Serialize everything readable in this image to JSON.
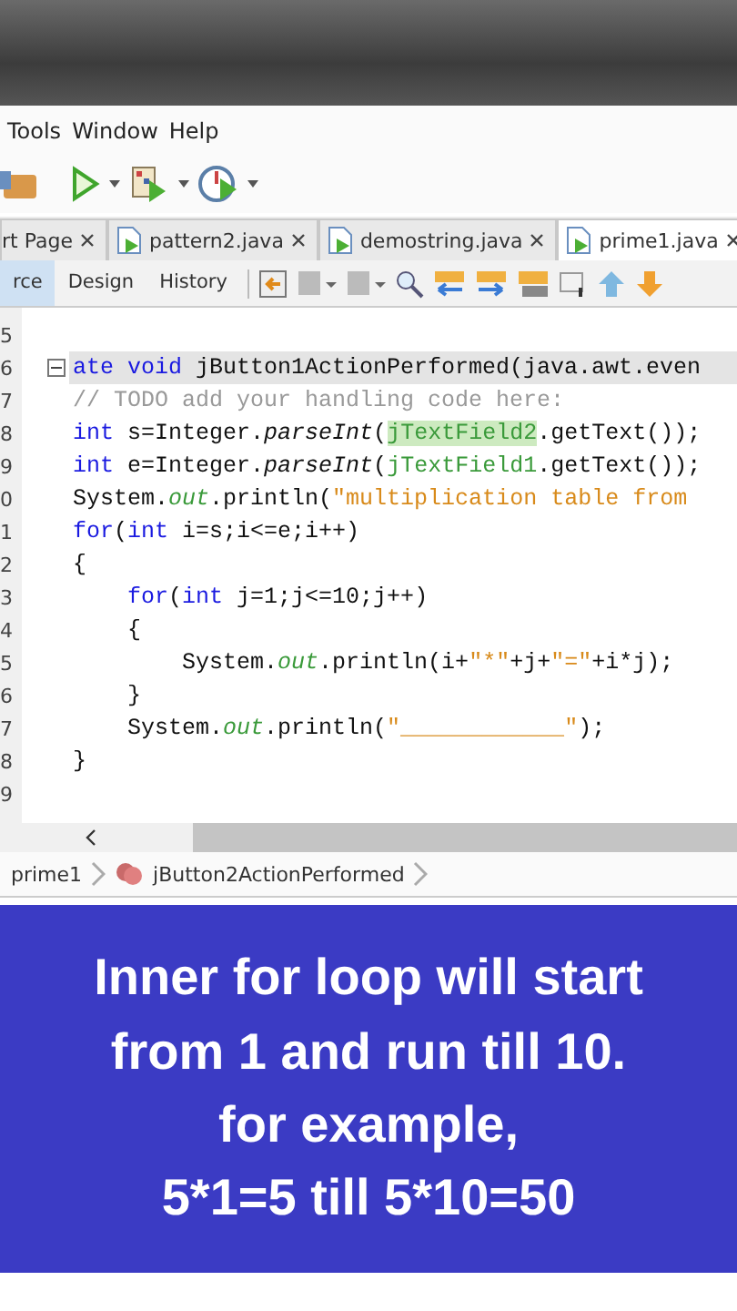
{
  "menu": [
    "Tools",
    "Window",
    "Help"
  ],
  "tabs": [
    {
      "label": "rt Page",
      "selected": false
    },
    {
      "label": "pattern2.java",
      "selected": false
    },
    {
      "label": "demostring.java",
      "selected": false
    },
    {
      "label": "prime1.java",
      "selected": true
    }
  ],
  "view_tabs": [
    {
      "label": "rce",
      "selected": true
    },
    {
      "label": "Design",
      "selected": false
    },
    {
      "label": "History",
      "selected": false
    }
  ],
  "code_lines": [
    {
      "number": "5",
      "current": false
    },
    {
      "number": "6",
      "current": true,
      "fold": true,
      "segments": [
        {
          "kind": "keyword",
          "text": "ate void "
        },
        {
          "kind": "plain",
          "text": "jButton1ActionPerformed(java.awt.even"
        }
      ]
    },
    {
      "number": "7",
      "current": false,
      "segments": [
        {
          "kind": "comment",
          "text": "// TODO add your handling code here:"
        }
      ]
    },
    {
      "number": "8",
      "current": false,
      "segments": [
        {
          "kind": "keyword",
          "text": "int "
        },
        {
          "kind": "plain",
          "text": "s=Integer."
        },
        {
          "kind": "method",
          "text": "parseInt"
        },
        {
          "kind": "plain",
          "text": "("
        },
        {
          "kind": "highlight",
          "text": "jTextField2"
        },
        {
          "kind": "plain",
          "text": ".getText());"
        }
      ]
    },
    {
      "number": "9",
      "current": false,
      "segments": [
        {
          "kind": "keyword",
          "text": "int "
        },
        {
          "kind": "plain",
          "text": "e=Integer."
        },
        {
          "kind": "method",
          "text": "parseInt"
        },
        {
          "kind": "plain",
          "text": "("
        },
        {
          "kind": "field",
          "text": "jTextField1"
        },
        {
          "kind": "plain",
          "text": ".getText());"
        }
      ]
    },
    {
      "number": "0",
      "current": false,
      "segments": [
        {
          "kind": "plain",
          "text": "System."
        },
        {
          "kind": "static",
          "text": "out"
        },
        {
          "kind": "plain",
          "text": ".println("
        },
        {
          "kind": "string",
          "text": "\"multiplication table from"
        }
      ]
    },
    {
      "number": "1",
      "current": false,
      "segments": [
        {
          "kind": "keyword",
          "text": "for"
        },
        {
          "kind": "plain",
          "text": "("
        },
        {
          "kind": "keyword",
          "text": "int "
        },
        {
          "kind": "plain",
          "text": "i=s;i<=e;i++)"
        }
      ]
    },
    {
      "number": "2",
      "current": false,
      "segments": [
        {
          "kind": "plain",
          "text": "{"
        }
      ]
    },
    {
      "number": "3",
      "current": false,
      "segments": [
        {
          "kind": "keyword",
          "text": "    for"
        },
        {
          "kind": "plain",
          "text": "("
        },
        {
          "kind": "keyword",
          "text": "int "
        },
        {
          "kind": "plain",
          "text": "j=1;j<=10;j++)"
        }
      ]
    },
    {
      "number": "4",
      "current": false,
      "segments": [
        {
          "kind": "plain",
          "text": "    {"
        }
      ]
    },
    {
      "number": "5",
      "current": false,
      "segments": [
        {
          "kind": "plain",
          "text": "        System."
        },
        {
          "kind": "static",
          "text": "out"
        },
        {
          "kind": "plain",
          "text": ".println(i+"
        },
        {
          "kind": "string",
          "text": "\"*\""
        },
        {
          "kind": "plain",
          "text": "+j+"
        },
        {
          "kind": "string",
          "text": "\"=\""
        },
        {
          "kind": "plain",
          "text": "+i*j);"
        }
      ]
    },
    {
      "number": "6",
      "current": false,
      "segments": [
        {
          "kind": "plain",
          "text": "    }"
        }
      ]
    },
    {
      "number": "7",
      "current": false,
      "segments": [
        {
          "kind": "plain",
          "text": "    System."
        },
        {
          "kind": "static",
          "text": "out"
        },
        {
          "kind": "plain",
          "text": ".println("
        },
        {
          "kind": "string",
          "text": "\"____________\""
        },
        {
          "kind": "plain",
          "text": ");"
        }
      ]
    },
    {
      "number": "8",
      "current": false,
      "segments": [
        {
          "kind": "plain",
          "text": "}"
        }
      ]
    },
    {
      "number": "9",
      "current": false
    }
  ],
  "breadcrumb": [
    "prime1",
    "jButton2ActionPerformed"
  ],
  "caption": [
    "Inner for loop will start",
    "from 1 and run till 10.",
    "for example,",
    "5*1=5 till 5*10=50"
  ]
}
